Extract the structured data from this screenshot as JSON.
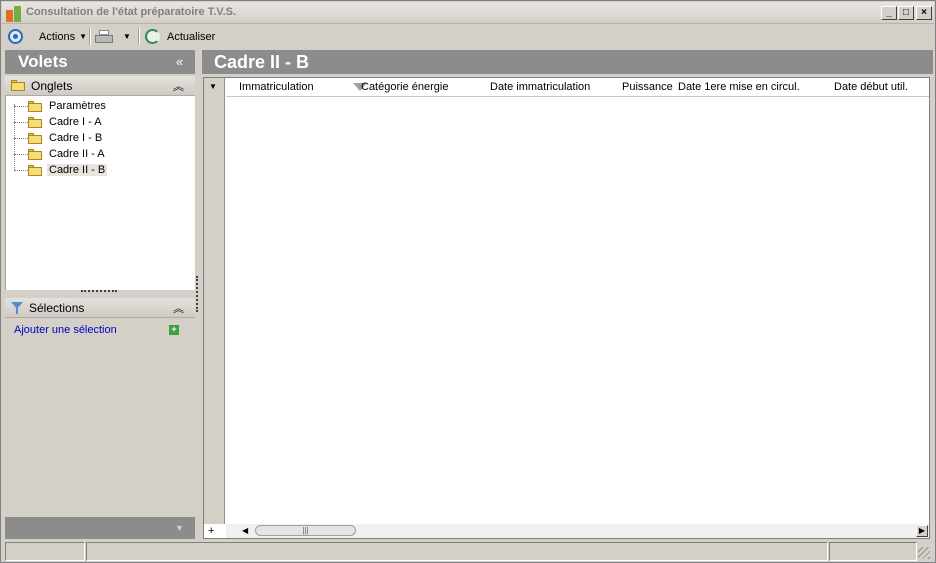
{
  "window": {
    "title": "Consultation de l'état préparatoire T.V.S.",
    "controls": {
      "minimize": "_",
      "maximize": "□",
      "close": "×"
    }
  },
  "toolbar": {
    "actions_label": "Actions",
    "refresh_label": "Actualiser",
    "icons": [
      "actions-icon",
      "printer-icon",
      "refresh-icon"
    ]
  },
  "sidebar": {
    "title": "Volets",
    "collapse_symbol": "«",
    "onglets": {
      "label": "Onglets",
      "toggle": "⌃",
      "items": [
        {
          "label": "Paramètres"
        },
        {
          "label": "Cadre I - A"
        },
        {
          "label": "Cadre I - B"
        },
        {
          "label": "Cadre II - A"
        },
        {
          "label": "Cadre II - B",
          "selected": true
        }
      ]
    },
    "selections": {
      "label": "Sélections",
      "toggle": "⌃",
      "add_link": "Ajouter une sélection",
      "add_symbol": "+"
    }
  },
  "main": {
    "title": "Cadre II - B",
    "grid": {
      "columns": [
        "Immatriculation",
        "Catégorie énergie",
        "Date immatriculation",
        "Puissance",
        "Date 1ere mise en circul.",
        "Date début util."
      ],
      "rows": [],
      "add_row_symbol": "+",
      "scroll_thumb_grip": "|||"
    }
  },
  "statusbar": {
    "cells": [
      "",
      "",
      ""
    ]
  },
  "colors": {
    "chrome": "#d4d0c8",
    "pane_header": "#8c8c8c",
    "link": "#0000c0",
    "folder": "#f8dc70"
  }
}
